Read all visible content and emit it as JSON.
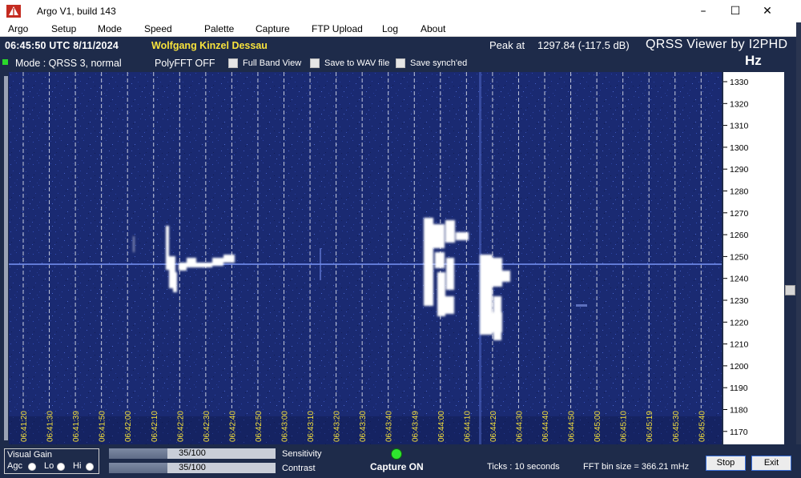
{
  "window": {
    "title": "Argo V1, build 143",
    "min_glyph": "–",
    "max_glyph": "☐",
    "close_glyph": "✕"
  },
  "menu": [
    "Argo",
    "Setup",
    "Mode",
    "Speed",
    "Palette",
    "Capture",
    "FTP Upload",
    "Log",
    "About"
  ],
  "header": {
    "clock": "06:45:50 UTC  8/11/2024",
    "station": "Wolfgang Kinzel Dessau",
    "peak_label": "Peak at",
    "peak_value": "1297.84 (-117.5 dB)",
    "viewer_title": "QRSS Viewer by I2PHD",
    "unit": "Hz",
    "mode": "Mode : QRSS 3, normal",
    "polyfft": "PolyFFT OFF",
    "options": [
      "Full Band View",
      "Save to WAV file",
      "Save synch'ed"
    ]
  },
  "waterfall": {
    "time_labels": [
      "06:41:20",
      "06:41:30",
      "06:41:39",
      "06:41:50",
      "06:42:00",
      "06:42:10",
      "06:42:20",
      "06:42:30",
      "06:42:40",
      "06:42:50",
      "06:43:00",
      "06:43:10",
      "06:43:20",
      "06:43:30",
      "06:43:40",
      "06:43:49",
      "06:44:00",
      "06:44:10",
      "06:44:20",
      "06:44:30",
      "06:44:40",
      "06:44:50",
      "06:45:00",
      "06:45:10",
      "06:45:19",
      "06:45:30",
      "06:45:40"
    ],
    "freq_labels": [
      "1330",
      "1320",
      "1310",
      "1300",
      "1290",
      "1280",
      "1270",
      "1260",
      "1250",
      "1240",
      "1230",
      "1220",
      "1210",
      "1200",
      "1190",
      "1180",
      "1170"
    ],
    "colors": {
      "background": "#1b2b73",
      "gridline": "#ffffff",
      "time_label": "#f7e23b",
      "signal": "#ffffff"
    }
  },
  "bottom": {
    "visual_gain": "Visual Gain",
    "gain_options": [
      "Agc",
      "Lo",
      "Hi"
    ],
    "sensitivity_value": "35/100",
    "sensitivity_fraction": 0.35,
    "sensitivity_label": "Sensitivity",
    "contrast_value": "35/100",
    "contrast_fraction": 0.35,
    "contrast_label": "Contrast",
    "capture_label": "Capture ON",
    "ticks": "Ticks  :  10 seconds",
    "fft_bin": "FFT bin size = 366.21 mHz",
    "stop_button": "Stop",
    "exit_button": "Exit"
  }
}
